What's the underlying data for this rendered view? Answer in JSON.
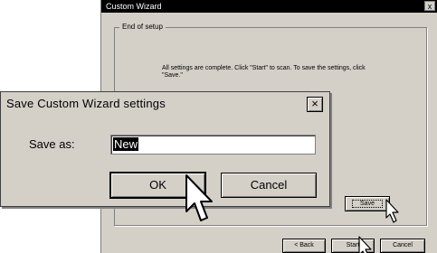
{
  "wizard": {
    "title": "Custom Wizard",
    "close_glyph": "x",
    "group_label": "End of setup",
    "message": "All settings are complete. Click \"Start\" to scan. To save the settings, click \"Save.\"",
    "save_label": "Save",
    "back_label": "< Back",
    "start_label": "Start",
    "cancel_label": "Cancel"
  },
  "dialog": {
    "title": "Save Custom Wizard settings",
    "close_glyph": "×",
    "save_as_label": "Save as:",
    "save_as_value": "New",
    "ok_label": "OK",
    "cancel_label": "Cancel"
  },
  "icons": [
    "pointer-cursor-icon"
  ]
}
